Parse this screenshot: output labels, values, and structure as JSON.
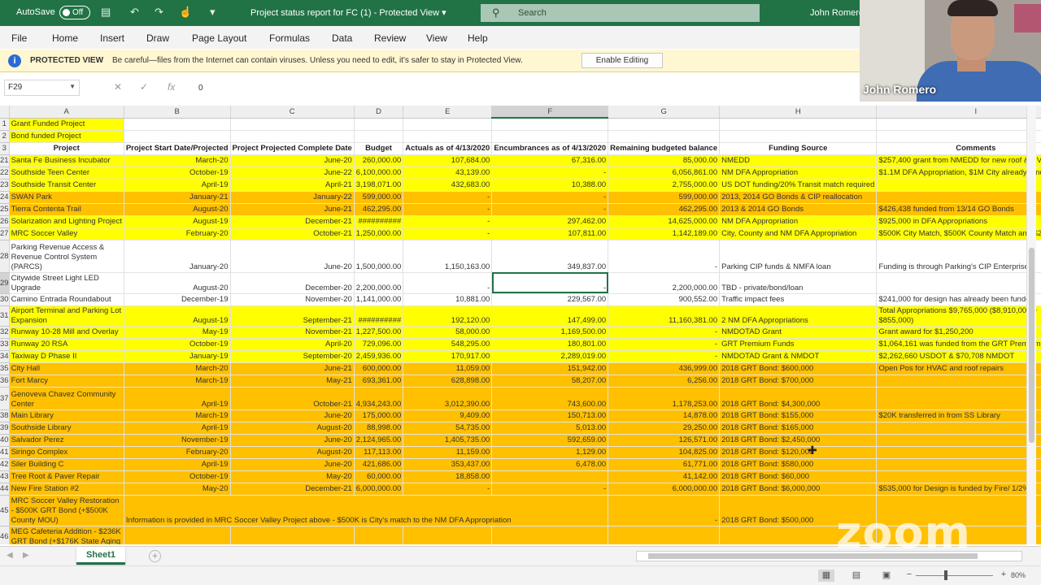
{
  "titlebar": {
    "autosave_label": "AutoSave",
    "autosave_state": "Off",
    "doc_title": "Project status report for FC (1)  -  Protected View  ▾",
    "search_placeholder": "Search",
    "user_name": "John Romero",
    "bar_color": "#217346"
  },
  "menu": {
    "items": [
      "File",
      "Home",
      "Insert",
      "Draw",
      "Page Layout",
      "Formulas",
      "Data",
      "Review",
      "View",
      "Help"
    ]
  },
  "protected_view": {
    "label": "PROTECTED VIEW",
    "message": "Be careful—files from the Internet can contain viruses. Unless you need to edit, it's safer to stay in Protected View.",
    "button": "Enable Editing",
    "icon": "info-icon"
  },
  "formula_bar": {
    "cell_ref": "F29",
    "fx": "fx",
    "value": "0"
  },
  "colors": {
    "yellow": "#ffff00",
    "orange": "#ffc000",
    "accent": "#217346"
  },
  "sheet": {
    "columns": [
      "A",
      "B",
      "C",
      "D",
      "E",
      "F",
      "G",
      "H",
      "I",
      "J",
      "K",
      "L",
      "M"
    ],
    "rows": [
      {
        "n": "1",
        "fill": "none",
        "cells": [
          "Grant Funded Project",
          "",
          "",
          "",
          "",
          "",
          "",
          "",
          "",
          "",
          "",
          "",
          ""
        ]
      },
      {
        "n": "2",
        "fill": "none",
        "cells": [
          "Bond funded Project",
          "",
          "",
          "",
          "",
          "",
          "",
          "",
          "",
          "",
          "",
          "",
          ""
        ]
      },
      {
        "n": "3",
        "fill": "none",
        "cells": [
          "Project",
          "Project Start Date/Projected",
          "Project Projected Complete Date",
          "Budget",
          "Actuals as of 4/13/2020",
          "Encumbrances as of 4/13/2020",
          "Remaining budgeted balance",
          "Funding Source",
          "Comments",
          "",
          "",
          "",
          ""
        ]
      },
      {
        "n": "21",
        "fill": "yellow",
        "cells": [
          "Santa Fe Business Incubator",
          "March-20",
          "June-20",
          "260,000.00",
          "107,684.00",
          "67,316.00",
          "85,000.00",
          "NMEDD",
          "$257,400 grant from NMEDD for new roof & HVAC",
          "",
          "",
          "",
          ""
        ]
      },
      {
        "n": "22",
        "fill": "yellow",
        "cells": [
          "Southside Teen Center",
          "October-19",
          "June-22",
          "6,100,000.00",
          "43,139.00",
          "-",
          "6,056,861.00",
          "NM DFA Appropriation",
          "$1.1M DFA Appropriation, $1M City already funded",
          "",
          "",
          "",
          ""
        ]
      },
      {
        "n": "23",
        "fill": "yellow",
        "cells": [
          "Southside Transit Center",
          "April-19",
          "April-21",
          "3,198,071.00",
          "432,683.00",
          "10,388.00",
          "2,755,000.00",
          "US DOT funding/20% Transit match required",
          "",
          "",
          "",
          "",
          ""
        ]
      },
      {
        "n": "24",
        "fill": "orange",
        "cells": [
          "SWAN Park",
          "January-21",
          "January-22",
          "599,000.00",
          "-",
          "-",
          "599,000.00",
          "2013, 2014 GO Bonds & CIP reallocation",
          "",
          "",
          "",
          "",
          ""
        ]
      },
      {
        "n": "25",
        "fill": "orange",
        "cells": [
          "Tierra Contenta Trail",
          "August-20",
          "June-21",
          "462,295.00",
          "-",
          "-",
          "462,295.00",
          "2013 & 2014 GO Bonds",
          "$426,438 funded from 13/14 GO Bonds",
          "",
          "",
          "",
          ""
        ]
      },
      {
        "n": "26",
        "fill": "yellow",
        "cells": [
          "Solarization and Lighting Project",
          "August-19",
          "December-21",
          "##########",
          "-",
          "297,462.00",
          "14,625,000.00",
          "NM DFA Appropriation",
          "$925,000 in DFA Appropriations",
          "",
          "",
          "",
          ""
        ]
      },
      {
        "n": "27",
        "fill": "yellow",
        "cells": [
          "MRC Soccer Valley",
          "February-20",
          "October-21",
          "1,250,000.00",
          "-",
          "107,811.00",
          "1,142,189.00",
          "City, County and NM DFA Appropriation",
          "$500K City Match, $500K County Match and $250K DFA",
          "",
          "",
          "",
          ""
        ]
      },
      {
        "n": "28",
        "fill": "none",
        "tall": 40,
        "cells": [
          "Parking Revenue Access & Revenue Control System (PARCS)",
          "January-20",
          "June-20",
          "1,500,000.00",
          "1,150,163.00",
          "349,837.00",
          "-",
          "Parking CIP funds & NMFA loan",
          "Funding is through Parking's CIP Enterprise",
          "",
          "",
          "",
          ""
        ]
      },
      {
        "n": "29",
        "fill": "none",
        "tall": 26,
        "cells": [
          "Citywide Street Light LED Upgrade",
          "August-20",
          "December-20",
          "2,200,000.00",
          "-",
          "-",
          "2,200,000.00",
          "TBD - private/bond/loan",
          "",
          "",
          "",
          "",
          ""
        ]
      },
      {
        "n": "30",
        "fill": "none",
        "cells": [
          "Camino Entrada Roundabout",
          "December-19",
          "November-20",
          "1,141,000.00",
          "10,881.00",
          "229,567.00",
          "900,552.00",
          "Traffic impact fees",
          "$241,000 for design has already been funded",
          "",
          "",
          "",
          ""
        ]
      },
      {
        "n": "31",
        "fill": "yellow",
        "tall": 24,
        "cells": [
          "Airport Terminal and Parking Lot Expansion",
          "August-19",
          "September-21",
          "##########",
          "192,120.00",
          "147,499.00",
          "11,160,381.00",
          "2 NM DFA Appropriations",
          "Total Appropriations $9,765,000 ($8,910,000 + $855,000)",
          "",
          "",
          "",
          ""
        ]
      },
      {
        "n": "32",
        "fill": "yellow",
        "cells": [
          "Runway 10-28 Mill and Overlay",
          "May-19",
          "November-21",
          "1,227,500.00",
          "58,000.00",
          "1,169,500.00",
          "-",
          "NMDOTAD Grant",
          "Grant award for $1,250,200",
          "",
          "",
          "",
          ""
        ]
      },
      {
        "n": "33",
        "fill": "yellow",
        "cells": [
          "Runway 20 RSA",
          "October-19",
          "April-20",
          "729,096.00",
          "548,295.00",
          "180,801.00",
          "-",
          "GRT Premium Funds",
          "$1,064,161 was funded from the GRT Premium",
          "",
          "",
          "",
          ""
        ]
      },
      {
        "n": "34",
        "fill": "yellow",
        "cells": [
          "Taxiway D Phase II",
          "January-19",
          "September-20",
          "2,459,936.00",
          "170,917.00",
          "2,289,019.00",
          "-",
          "NMDOTAD Grant & NMDOT",
          "$2,262,660 USDOT & $70,708 NMDOT",
          "",
          "",
          "",
          ""
        ]
      },
      {
        "n": "35",
        "fill": "orange",
        "cells": [
          "City Hall",
          "March-20",
          "June-21",
          "600,000.00",
          "11,059.00",
          "151,942.00",
          "436,999.00",
          "2018 GRT Bond: $600,000",
          "Open Pos for HVAC and roof repairs",
          "Repairs",
          "",
          "",
          ""
        ]
      },
      {
        "n": "36",
        "fill": "orange",
        "cells": [
          "Fort Marcy",
          "March-19",
          "May-21",
          "693,361.00",
          "628,898.00",
          "58,207.00",
          "6,256.00",
          "2018 GRT Bond: $700,000",
          "",
          "",
          "",
          "",
          ""
        ]
      },
      {
        "n": "37",
        "fill": "orange",
        "tall": 28,
        "cells": [
          "Genoveva Chavez Community Center",
          "April-19",
          "October-21",
          "4,934,243.00",
          "3,012,390.00",
          "743,600.00",
          "1,178,253.00",
          "2018 GRT Bond: $4,300,000",
          "",
          "",
          "",
          "",
          ""
        ]
      },
      {
        "n": "38",
        "fill": "orange",
        "cells": [
          "Main Library",
          "March-19",
          "June-20",
          "175,000.00",
          "9,409.00",
          "150,713.00",
          "14,878.00",
          "2018 GRT Bond: $155,000",
          "$20K transferred in from SS Library",
          "",
          "",
          "",
          ""
        ]
      },
      {
        "n": "39",
        "fill": "orange",
        "cells": [
          "Southside Library",
          "April-19",
          "August-20",
          "88,998.00",
          "54,735.00",
          "5,013.00",
          "29,250.00",
          "2018 GRT Bond: $165,000",
          "",
          "",
          "",
          "",
          ""
        ]
      },
      {
        "n": "40",
        "fill": "orange",
        "cells": [
          "Salvador Perez",
          "November-19",
          "June-20",
          "2,124,965.00",
          "1,405,735.00",
          "592,659.00",
          "126,571.00",
          "2018 GRT Bond: $2,450,000",
          "",
          "",
          "",
          "",
          ""
        ]
      },
      {
        "n": "41",
        "fill": "orange",
        "cells": [
          "Siringo Complex",
          "February-20",
          "August-20",
          "117,113.00",
          "11,159.00",
          "1,129.00",
          "104,825.00",
          "2018 GRT Bond: $120,000",
          "",
          "",
          "",
          "",
          ""
        ]
      },
      {
        "n": "42",
        "fill": "orange",
        "cells": [
          "Siler Building C",
          "April-19",
          "June-20",
          "421,686.00",
          "353,437.00",
          "6,478.00",
          "61,771.00",
          "2018 GRT Bond: $580,000",
          "",
          "",
          "",
          "",
          ""
        ]
      },
      {
        "n": "43",
        "fill": "orange",
        "cells": [
          "Tree Root & Paver Repair",
          "October-19",
          "May-20",
          "60,000.00",
          "18,858.00",
          "",
          "41,142.00",
          "2018 GRT Bond: $60,000",
          "",
          "",
          "",
          "",
          ""
        ]
      },
      {
        "n": "44",
        "fill": "orange",
        "cells": [
          "New Fire Station #2",
          "May-20",
          "December-21",
          "6,000,000.00",
          "-",
          "-",
          "6,000,000.00",
          "2018 GRT Bond: $6,000,000",
          "$535,000 for Design is funded by Fire/ 1/2%",
          "",
          "",
          "",
          ""
        ]
      },
      {
        "n": "45",
        "fill": "orange",
        "tall": 38,
        "span": true,
        "cells": [
          "MRC Soccer Valley Restoration - $500K GRT Bond (+$500K County MOU)",
          "Information is provided in MRC Soccer Valley Project above - $500K is City's match to the NM DFA Appropriation",
          "",
          "",
          "",
          "",
          "-",
          "2018 GRT Bond: $500,000",
          "",
          "",
          "",
          "",
          ""
        ]
      },
      {
        "n": "46",
        "fill": "orange",
        "tall": 26,
        "cells": [
          "MEG Cafeteria Addition - $236K GRT Bond (+$176K State Aging",
          "",
          "",
          "",
          "",
          "",
          "",
          "",
          "",
          "",
          "",
          "",
          ""
        ]
      }
    ]
  },
  "tabs": {
    "active": "Sheet1",
    "add_icon": "plus-icon"
  },
  "status": {
    "zoom": "80%"
  },
  "webcam": {
    "name": "John Romero"
  },
  "watermark": "zoom"
}
